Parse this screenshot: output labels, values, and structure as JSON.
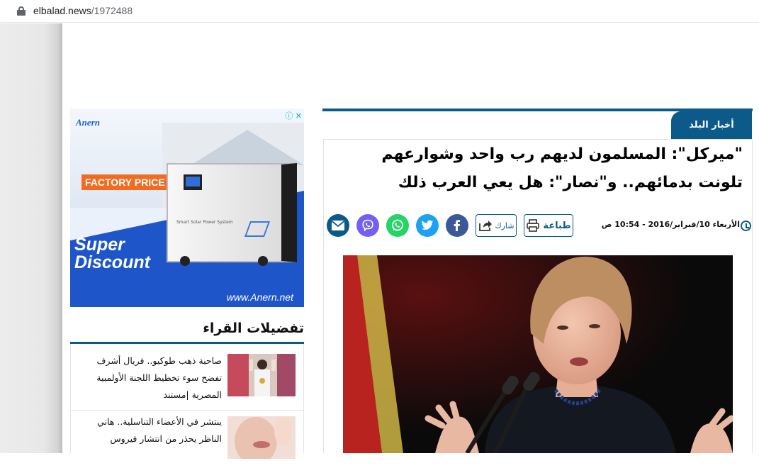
{
  "browser": {
    "url_domain": "elbalad.news",
    "url_path": "/1972488"
  },
  "ad": {
    "brand": "Anern",
    "badge": "FACTORY PRICE",
    "product_text": "Smart Solar Power System",
    "headline_line1": "Super",
    "headline_line2": "Discount",
    "website": "www.Anern.net",
    "close_glyphs": "ⓘ ✕"
  },
  "favorites": {
    "title": "تفضيلات القراء",
    "items": [
      {
        "text": "صاحبة ذهب طوكيو.. فريال أشرف تفضح سوء تخطيط اللجنة الأولمبية المصرية |مستند"
      },
      {
        "text": "ينتشر في الأعضاء التناسلية.. هاني الناظر يحذر من انتشار فيروس"
      }
    ]
  },
  "article": {
    "section": "أخبار البلد",
    "headline": "\"ميركل\": المسلمون لديهم رب واحد وشوارعهم تلونت بدمائهم.. و\"نصار\": هل يعي العرب ذلك",
    "date": "الأربعاء 10/فبراير/2016 - 10:54 ص",
    "print_label": "طباعة",
    "share_label": "شارك"
  },
  "colors": {
    "brand_blue": "#0b5a8a",
    "facebook": "#3b5998",
    "twitter": "#1da1f2",
    "whatsapp": "#25d366",
    "viber": "#7360f2",
    "email": "#0b5a8a"
  },
  "icons": {
    "social": [
      "email-icon",
      "viber-icon",
      "whatsapp-icon",
      "twitter-icon",
      "facebook-icon"
    ]
  }
}
